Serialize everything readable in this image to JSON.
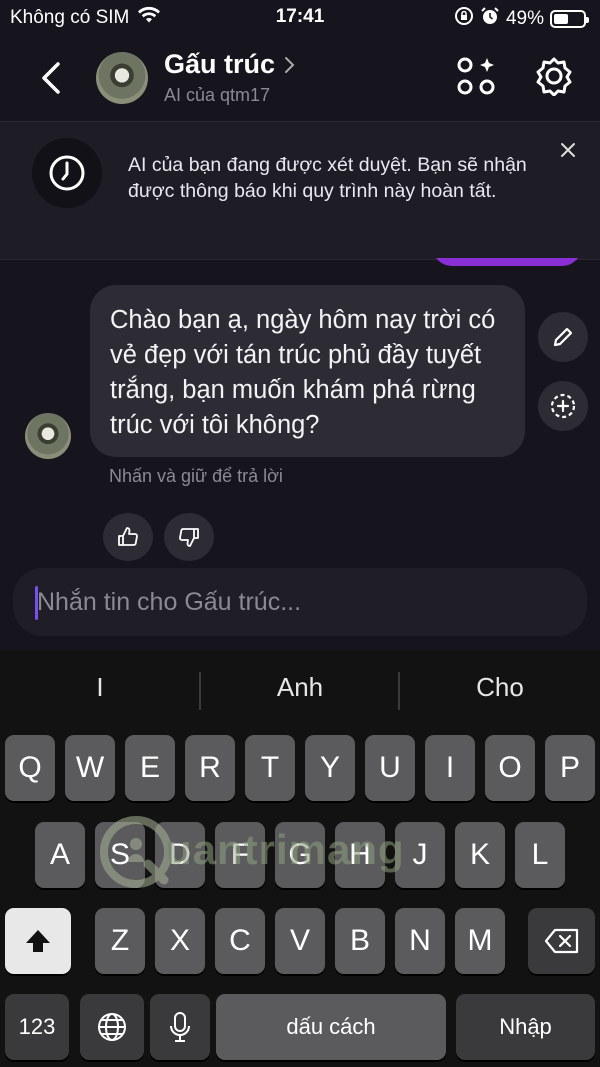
{
  "status_bar": {
    "carrier": "Không có SIM",
    "time": "17:41",
    "battery": "49%",
    "battery_level": 0.49
  },
  "header": {
    "title": "Gấu trúc",
    "subtitle": "AI của qtm17"
  },
  "notice": {
    "text": "AI của bạn đang được xét duyệt. Bạn sẽ nhận được thông báo khi quy trình này hoàn tất."
  },
  "message": {
    "text": "Chào bạn ạ, ngày hôm nay trời có vẻ đẹp với tán trúc phủ đầy tuyết trắng, bạn muốn khám phá rừng trúc với tôi không?",
    "hint": "Nhấn và giữ để trả lời"
  },
  "composer": {
    "placeholder": "Nhắn tin cho Gấu trúc..."
  },
  "keyboard": {
    "suggestions": [
      "I",
      "Anh",
      "Cho"
    ],
    "row1": [
      "Q",
      "W",
      "E",
      "R",
      "T",
      "Y",
      "U",
      "I",
      "O",
      "P"
    ],
    "row2": [
      "A",
      "S",
      "D",
      "F",
      "G",
      "H",
      "J",
      "K",
      "L"
    ],
    "row3": [
      "Z",
      "X",
      "C",
      "V",
      "B",
      "N",
      "M"
    ],
    "numbers_key": "123",
    "space_key": "dấu cách",
    "return_key": "Nhập"
  },
  "watermark": "uantrimang",
  "icons": [
    "back-icon",
    "chevron-right-icon",
    "apps-sparkle-icon",
    "settings-icon",
    "clock-icon",
    "close-icon",
    "pencil-icon",
    "add-circle-icon",
    "thumbs-up-icon",
    "thumbs-down-icon",
    "shift-icon",
    "backspace-icon",
    "globe-icon",
    "microphone-icon",
    "wifi-icon",
    "alarm-icon",
    "rotation-lock-icon",
    "battery-icon"
  ]
}
